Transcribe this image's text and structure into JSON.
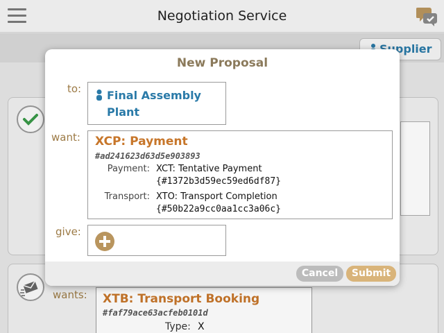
{
  "app": {
    "title": "Negotiation Service"
  },
  "header": {
    "menu_icon": "hamburger-menu-icon",
    "chat_icon": "chat-bubbles-icon"
  },
  "tabs": {
    "supplier_label": "Supplier"
  },
  "background_card": {
    "wants_label": "wants:",
    "title": "XTB: Transport Booking",
    "hash": "#faf79ace63acfeb0101d",
    "type_label": "Type:",
    "type_value": "X"
  },
  "modal": {
    "title": "New Proposal",
    "to_label": "to:",
    "to_value": "Final Assembly Plant",
    "want_label": "want:",
    "want": {
      "title": "XCP: Payment",
      "hash": "#ad241623d63d5e903893",
      "rows": [
        {
          "label": "Payment:",
          "value": "XCT: Tentative Payment",
          "ref": "{#1372b3d59ec59ed6df87}"
        },
        {
          "label": "Transport:",
          "value": "XTO: Transport Completion",
          "ref": "{#50b22a9cc0aa1cc3a06c}"
        }
      ]
    },
    "give_label": "give:",
    "cancel_label": "Cancel",
    "submit_label": "Submit"
  },
  "colors": {
    "accent_orange": "#c7762a",
    "link_blue": "#2a7aa8",
    "label_tan": "#9c7a45",
    "submit_bg": "#d9b47a",
    "cancel_bg": "#bcbcbc"
  }
}
